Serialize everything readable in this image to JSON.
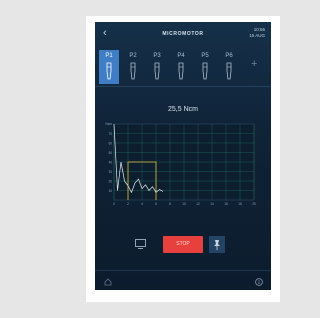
{
  "header": {
    "title": "MICROMOTOR",
    "time": "10:56",
    "date": "15 AUG"
  },
  "programs": {
    "tabs": [
      {
        "label": "P1",
        "active": true
      },
      {
        "label": "P2",
        "active": false
      },
      {
        "label": "P3",
        "active": false
      },
      {
        "label": "P4",
        "active": false
      },
      {
        "label": "P5",
        "active": false
      },
      {
        "label": "P6",
        "active": false
      }
    ],
    "add_label": "+"
  },
  "torque": {
    "value_text": "25,5 Ncm"
  },
  "chart_data": {
    "type": "line",
    "ylabel": "Ncm",
    "xlim": [
      0,
      20
    ],
    "ylim": [
      0,
      80
    ],
    "x_ticks": [
      0,
      2,
      4,
      6,
      8,
      10,
      12,
      14,
      16,
      18,
      20
    ],
    "y_ticks": [
      10,
      20,
      30,
      40,
      50,
      60,
      70
    ],
    "grid": true,
    "threshold": {
      "value": 40,
      "x_start": 2,
      "x_end": 6
    },
    "series": [
      {
        "values": [
          [
            0,
            80
          ],
          [
            0.5,
            10
          ],
          [
            1,
            40
          ],
          [
            1.5,
            20
          ],
          [
            2,
            15
          ],
          [
            2.5,
            8
          ],
          [
            3,
            18
          ],
          [
            3.5,
            22
          ],
          [
            4,
            12
          ],
          [
            4.5,
            16
          ],
          [
            5,
            10
          ],
          [
            5.5,
            14
          ],
          [
            6,
            8
          ],
          [
            6.5,
            11
          ],
          [
            7,
            9
          ]
        ]
      }
    ]
  },
  "controls": {
    "stop_label": "STOP"
  },
  "icons": {
    "back": "chevron-left-icon",
    "monitor": "monitor-icon",
    "pin": "pin-icon",
    "home": "home-icon",
    "info": "info-icon"
  },
  "colors": {
    "accent": "#3f7dc4",
    "stop": "#e8403c",
    "threshold": "#e2c23a",
    "trace": "#e6eef5",
    "grid": "#1f6b5c"
  }
}
